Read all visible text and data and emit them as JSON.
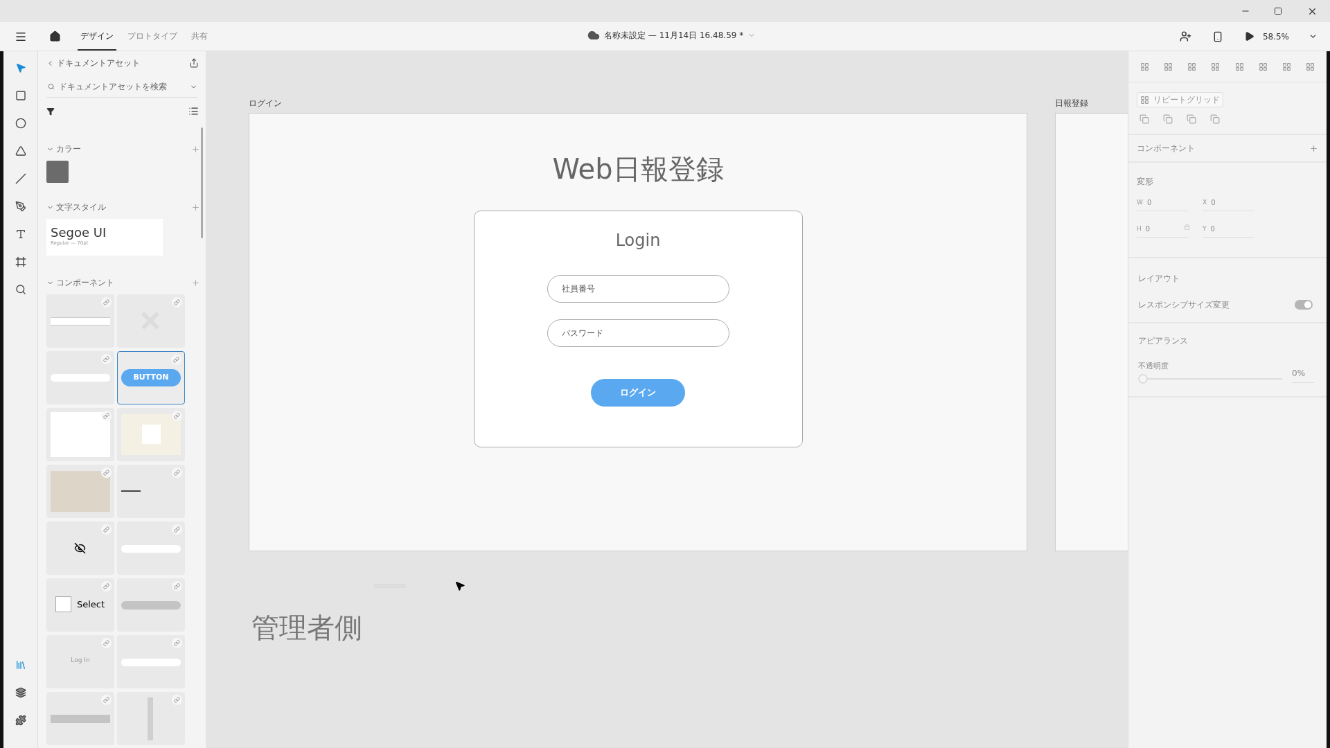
{
  "app_bar": {
    "tabs": [
      {
        "label": "デザイン",
        "selected": true
      },
      {
        "label": "プロトタイプ",
        "selected": false
      },
      {
        "label": "共有",
        "selected": false
      }
    ],
    "document_title": "名称未設定 — 11月14日 16.48.59 *",
    "zoom": "58.5%"
  },
  "tools": [
    {
      "kind": "select",
      "selected": true
    },
    {
      "kind": "rectangle",
      "selected": false
    },
    {
      "kind": "ellipse",
      "selected": false
    },
    {
      "kind": "polygon",
      "selected": false
    },
    {
      "kind": "line",
      "selected": false
    },
    {
      "kind": "pen",
      "selected": false
    },
    {
      "kind": "text",
      "selected": false
    },
    {
      "kind": "artboard",
      "selected": false
    },
    {
      "kind": "zoom",
      "selected": false
    }
  ],
  "bottom_tools": [
    {
      "kind": "assets",
      "selected": true
    },
    {
      "kind": "layers",
      "selected": false
    },
    {
      "kind": "plugins",
      "selected": false
    }
  ],
  "assets": {
    "title": "ドキュメントアセット",
    "search_placeholder": "ドキュメントアセットを検索",
    "colors": {
      "heading": "カラー",
      "expanded": true,
      "swatches": [
        {
          "color": "#6b6b6b"
        }
      ]
    },
    "text_styles": {
      "heading": "文字スタイル",
      "expanded": true,
      "items": [
        {
          "name": "Segoe UI",
          "detail": "Regular — 70pt"
        }
      ]
    },
    "components": {
      "heading": "コンポーネント",
      "expanded": true,
      "items": [
        {
          "kind": "table",
          "selected": false
        },
        {
          "kind": "placeholder-x",
          "selected": false
        },
        {
          "kind": "input",
          "selected": false
        },
        {
          "kind": "button",
          "label": "BUTTON",
          "selected": true
        },
        {
          "kind": "card",
          "selected": false
        },
        {
          "kind": "screen",
          "selected": false
        },
        {
          "kind": "photo",
          "selected": false
        },
        {
          "kind": "password",
          "selected": false
        },
        {
          "kind": "eye-off",
          "selected": false
        },
        {
          "kind": "labeled-input",
          "selected": false
        },
        {
          "kind": "checkbox",
          "label": "Select",
          "selected": false
        },
        {
          "kind": "pill",
          "selected": false
        },
        {
          "kind": "text",
          "label": "Log In",
          "selected": false
        },
        {
          "kind": "labeled-input",
          "selected": false
        },
        {
          "kind": "bar",
          "selected": false
        },
        {
          "kind": "column",
          "selected": false
        }
      ]
    }
  },
  "canvas": {
    "artboards": [
      {
        "name": "ログイン",
        "title": "Web日報登録",
        "card": {
          "heading": "Login",
          "fields": [
            {
              "placeholder": "社員番号"
            },
            {
              "placeholder": "パスワード"
            }
          ],
          "button": "ログイン"
        }
      },
      {
        "name": "日報登録"
      }
    ],
    "note": "管理者側"
  },
  "inspector": {
    "repeat_grid": "リピートグリッド",
    "component_heading": "コンポーネント",
    "transform_heading": "変形",
    "fields": [
      {
        "label": "W",
        "value": "0"
      },
      {
        "label": "X",
        "value": "0"
      },
      {
        "label": "H",
        "value": "0"
      },
      {
        "label": "Y",
        "value": "0"
      }
    ],
    "layout_heading": "レイアウト",
    "responsive": {
      "label": "レスポンシブサイズ変更",
      "on": true,
      "disabled": true
    },
    "appearance_heading": "アピアランス",
    "opacity": {
      "label": "不透明度",
      "level": 0,
      "reading": "0%"
    }
  }
}
